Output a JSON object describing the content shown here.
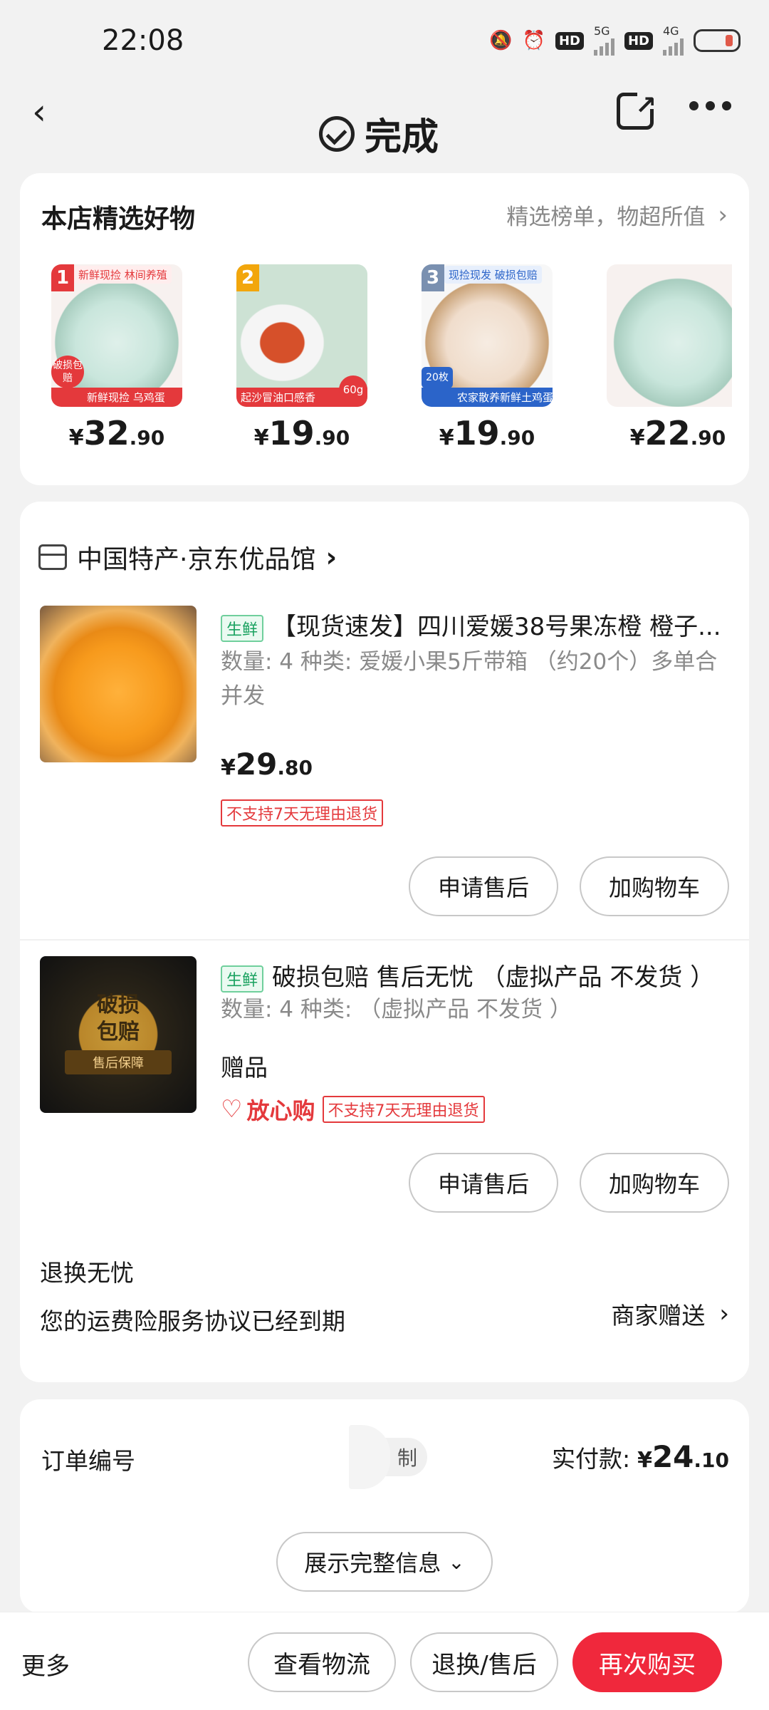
{
  "status_bar": {
    "time": "22:08",
    "network_1": "5G",
    "network_2": "4G",
    "hd": "HD"
  },
  "nav": {
    "title": "完成"
  },
  "picks": {
    "title": "本店精选好物",
    "more_label": "精选榜单，物超所值",
    "items": [
      {
        "rank": "1",
        "tag": "新鲜现捡 林间养殖",
        "caption": "新鲜现捡 乌鸡蛋",
        "side": "破损包赔",
        "price_int": "32",
        "price_dec": ".90",
        "currency": "¥"
      },
      {
        "rank": "2",
        "tag": "",
        "caption": "起沙冒油口感香",
        "side": "60g",
        "price_int": "19",
        "price_dec": ".90",
        "currency": "¥"
      },
      {
        "rank": "3",
        "tag": "现捡现发 破损包赔",
        "caption": "农家散养新鲜土鸡蛋",
        "side": "20枚",
        "price_int": "19",
        "price_dec": ".90",
        "currency": "¥"
      },
      {
        "rank": "",
        "tag": "",
        "caption": "",
        "side": "",
        "price_int": "22",
        "price_dec": ".90",
        "currency": "¥"
      }
    ]
  },
  "order": {
    "store_name": "中国特产·京东优品馆",
    "items": [
      {
        "tag": "生鲜",
        "title": "【现货速发】四川爱媛38号果冻橙 橙子...",
        "spec": "数量: 4   种类: 爱媛小果5斤带箱 （约20个）多单合并发",
        "currency": "¥",
        "price_int": "29",
        "price_dec": ".80",
        "no_return": "不支持7天无理由退货",
        "btn_after_sale": "申请售后",
        "btn_add_cart": "加购物车"
      },
      {
        "tag": "生鲜",
        "title": "破损包赔 售后无忧 （虚拟产品 不发货 ）",
        "spec": "数量: 4   种类: （虚拟产品 不发货 ）",
        "gift": "赠品",
        "worry_free": "放心购",
        "no_return": "不支持7天无理由退货",
        "image_text_1": "破损",
        "image_text_2": "包赔",
        "image_sub": "售后保障",
        "btn_after_sale": "申请售后",
        "btn_add_cart": "加购物车"
      }
    ],
    "exchange_title": "退换无忧",
    "insurance_text": "您的运费险服务协议已经到期",
    "merchant_gift": "商家赠送"
  },
  "info": {
    "order_no_label": "订单编号",
    "copy_label": "制",
    "paid_label": "实付款:",
    "currency": "¥",
    "paid_int": "24",
    "paid_dec": ".10",
    "show_all": "展示完整信息"
  },
  "bottom": {
    "more": "更多",
    "logistics": "查看物流",
    "return": "退换/售后",
    "rebuy": "再次购买"
  },
  "colors": {
    "accent_red": "#f0283c",
    "fresh_green": "#1aa260",
    "background": "#f2f2f2"
  }
}
